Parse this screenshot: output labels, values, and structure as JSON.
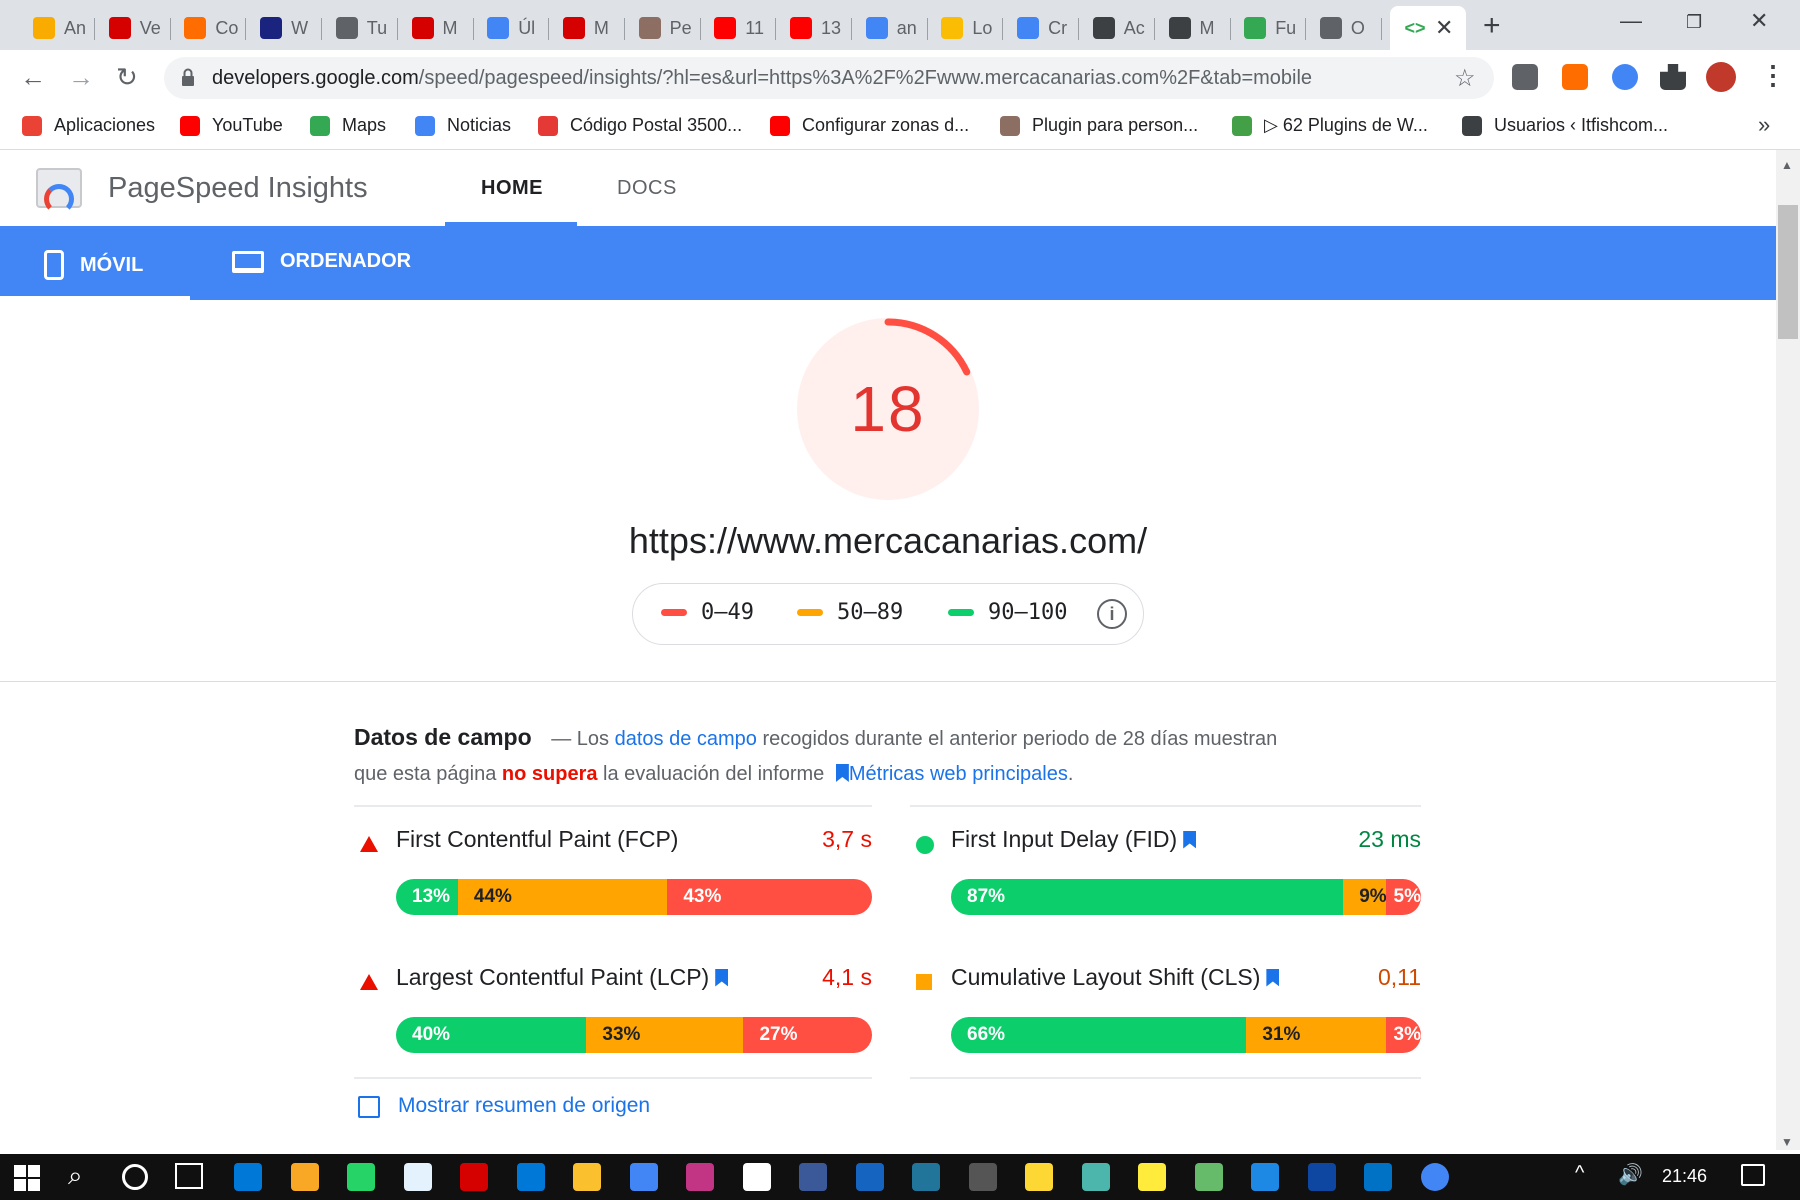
{
  "browser": {
    "tabs": [
      {
        "label": "An",
        "color": "#f9ab00"
      },
      {
        "label": "Ve",
        "color": "#d50000"
      },
      {
        "label": "Co",
        "color": "#ff6d00"
      },
      {
        "label": "W",
        "color": "#1a237e"
      },
      {
        "label": "Tu",
        "color": "#5f6368"
      },
      {
        "label": "M",
        "color": "#d50000"
      },
      {
        "label": "Úl",
        "color": "#4285f4"
      },
      {
        "label": "M",
        "color": "#d50000"
      },
      {
        "label": "Pe",
        "color": "#8d6e63"
      },
      {
        "label": "11",
        "color": "#ff0000"
      },
      {
        "label": "13",
        "color": "#ff0000"
      },
      {
        "label": "an",
        "color": "#4285f4"
      },
      {
        "label": "Lo",
        "color": "#fbbc04"
      },
      {
        "label": "Cr",
        "color": "#4285f4"
      },
      {
        "label": "Ac",
        "color": "#3c4043"
      },
      {
        "label": "M",
        "color": "#3c4043"
      },
      {
        "label": "Fu",
        "color": "#34a853"
      },
      {
        "label": "O",
        "color": "#5f6368"
      }
    ],
    "url_host": "developers.google.com",
    "url_path": "/speed/pagespeed/insights/?hl=es&url=https%3A%2F%2Fwww.mercacanarias.com%2F&tab=mobile",
    "bookmarks": [
      {
        "label": "Aplicaciones",
        "color": "#ea4335"
      },
      {
        "label": "YouTube",
        "color": "#ff0000"
      },
      {
        "label": "Maps",
        "color": "#34a853"
      },
      {
        "label": "Noticias",
        "color": "#4285f4"
      },
      {
        "label": "Código Postal 3500...",
        "color": "#e53935"
      },
      {
        "label": "Configurar zonas d...",
        "color": "#ff0000"
      },
      {
        "label": "Plugin para person...",
        "color": "#8d6e63"
      },
      {
        "label": "▷ 62 Plugins de W...",
        "color": "#43a047"
      },
      {
        "label": "Usuarios ‹ Itfishcom...",
        "color": "#3c4043"
      }
    ],
    "bookmarks_more": "»"
  },
  "header": {
    "product": "PageSpeed Insights",
    "nav": {
      "home": "HOME",
      "docs": "DOCS"
    }
  },
  "devices": {
    "mobile": "MÓVIL",
    "desktop": "ORDENADOR"
  },
  "score": {
    "value": "18",
    "fraction": 0.18,
    "color": "#ff4e42"
  },
  "site_url": "https://www.mercacanarias.com/",
  "legend": [
    {
      "label": "0–49",
      "color": "#ff4e42"
    },
    {
      "label": "50–89",
      "color": "#ffa400"
    },
    {
      "label": "90–100",
      "color": "#0cce6b"
    }
  ],
  "field_data": {
    "heading": "Datos de campo",
    "dash": "—",
    "text1": "Los",
    "link1": "datos de campo",
    "text2": "recogidos durante el anterior periodo de 28 días muestran",
    "text3": "que esta página",
    "fail": "no supera",
    "text4": "la evaluación del informe",
    "link2": "Métricas web principales",
    "period": ".",
    "metrics": [
      {
        "name": "First Contentful Paint (FCP)",
        "value": "3,7 s",
        "status": "fail",
        "good": "13%",
        "avg": "44%",
        "poor": "43%",
        "good_frac": 0.13,
        "avg_frac": 0.44,
        "poor_frac": 0.43
      },
      {
        "name": "First Input Delay (FID)",
        "value": "23 ms",
        "status": "pass",
        "good": "87%",
        "avg": "9%",
        "poor": "5%",
        "good_frac": 0.87,
        "avg_frac": 0.09,
        "poor_frac": 0.05
      },
      {
        "name": "Largest Contentful Paint (LCP)",
        "value": "4,1 s",
        "status": "fail",
        "good": "40%",
        "avg": "33%",
        "poor": "27%",
        "good_frac": 0.4,
        "avg_frac": 0.33,
        "poor_frac": 0.27
      },
      {
        "name": "Cumulative Layout Shift (CLS)",
        "value": "0,11",
        "status": "average",
        "good": "66%",
        "avg": "31%",
        "poor": "3%",
        "good_frac": 0.66,
        "avg_frac": 0.31,
        "poor_frac": 0.03
      }
    ],
    "origin_summary": "Mostrar resumen de origen"
  },
  "taskbar": {
    "time": "21:46"
  }
}
